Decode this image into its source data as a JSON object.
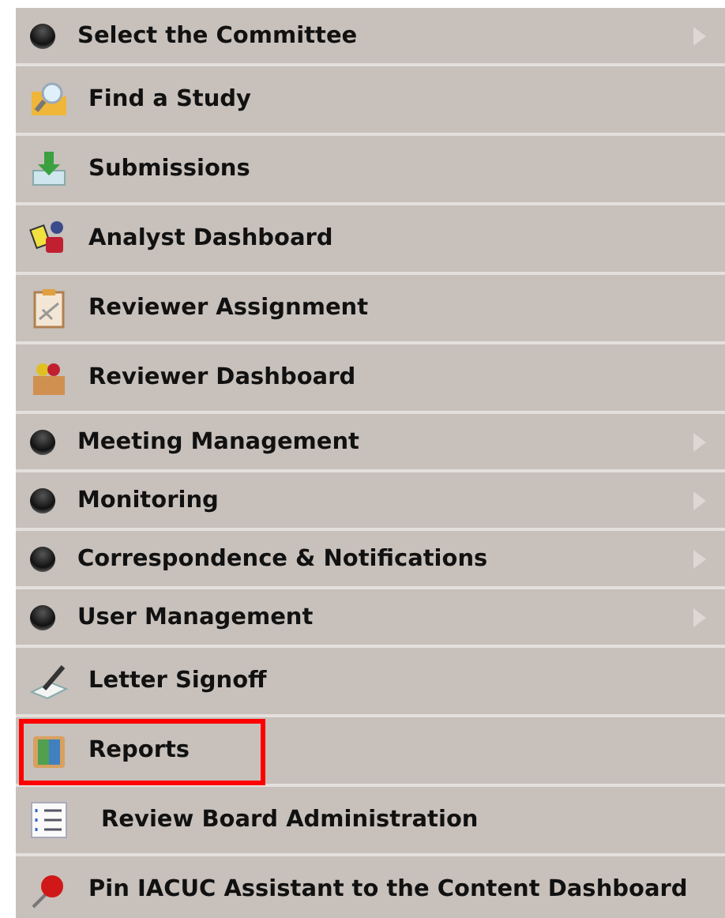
{
  "menu": {
    "items": [
      {
        "kind": "submenu",
        "label": "Select the Committee",
        "highlighted": false
      },
      {
        "kind": "link",
        "label": "Find a Study",
        "highlighted": false
      },
      {
        "kind": "link",
        "label": "Submissions",
        "highlighted": false
      },
      {
        "kind": "link",
        "label": "Analyst Dashboard",
        "highlighted": false
      },
      {
        "kind": "link",
        "label": "Reviewer Assignment",
        "highlighted": false
      },
      {
        "kind": "link",
        "label": "Reviewer Dashboard",
        "highlighted": false
      },
      {
        "kind": "submenu",
        "label": "Meeting Management",
        "highlighted": false
      },
      {
        "kind": "submenu",
        "label": "Monitoring",
        "highlighted": false
      },
      {
        "kind": "submenu",
        "label": "Correspondence & Notifications",
        "highlighted": false
      },
      {
        "kind": "submenu",
        "label": "User Management",
        "highlighted": false
      },
      {
        "kind": "link",
        "label": "Letter Signoff",
        "highlighted": false
      },
      {
        "kind": "link",
        "label": "Reports",
        "highlighted": true
      },
      {
        "kind": "link",
        "label": "Review Board Administration",
        "highlighted": false
      },
      {
        "kind": "link",
        "label": "Pin IACUC Assistant to the Content Dashboard",
        "highlighted": false
      }
    ]
  }
}
